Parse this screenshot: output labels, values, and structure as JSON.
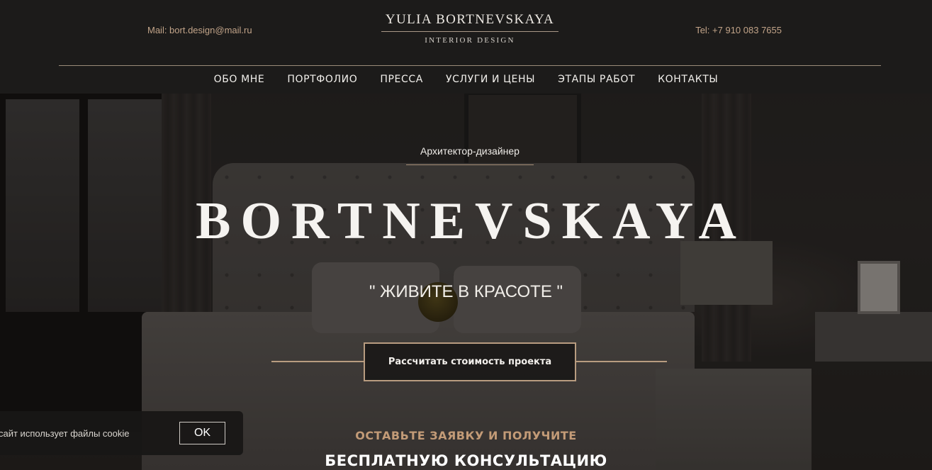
{
  "header": {
    "mail": "Mail: bort.design@mail.ru",
    "tel": "Tel: +7 910 083 7655",
    "logo_name": "YULIA BORTNEVSKAYA",
    "logo_sub": "INTERIOR DESIGN"
  },
  "nav": {
    "items": [
      {
        "label": "ОБО МНЕ"
      },
      {
        "label": "ПОРТФОЛИО"
      },
      {
        "label": "ПРЕССА"
      },
      {
        "label": "УСЛУГИ И ЦЕНЫ"
      },
      {
        "label": "ЭТАПЫ РАБОТ"
      },
      {
        "label": "КОНТАКТЫ"
      }
    ]
  },
  "hero": {
    "subtitle": "Архитектор-дизайнер",
    "brand": "BORTNEVSKAYA",
    "slogan": "\" ЖИВИТЕ В КРАСОТЕ \"",
    "cta_label": "Рассчитать стоимость проекта",
    "offer_line1": "ОСТАВЬТЕ ЗАЯВКУ И ПОЛУЧИТЕ",
    "offer_line2": "БЕСПЛАТНУЮ КОНСУЛЬТАЦИЮ"
  },
  "cookie": {
    "text": "сайт использует файлы cookie",
    "ok_label": "OK"
  },
  "colors": {
    "accent": "#c2a489",
    "header_bg": "#1c1b1a",
    "cta_border": "#b89c80",
    "offer": "#c39b77"
  }
}
